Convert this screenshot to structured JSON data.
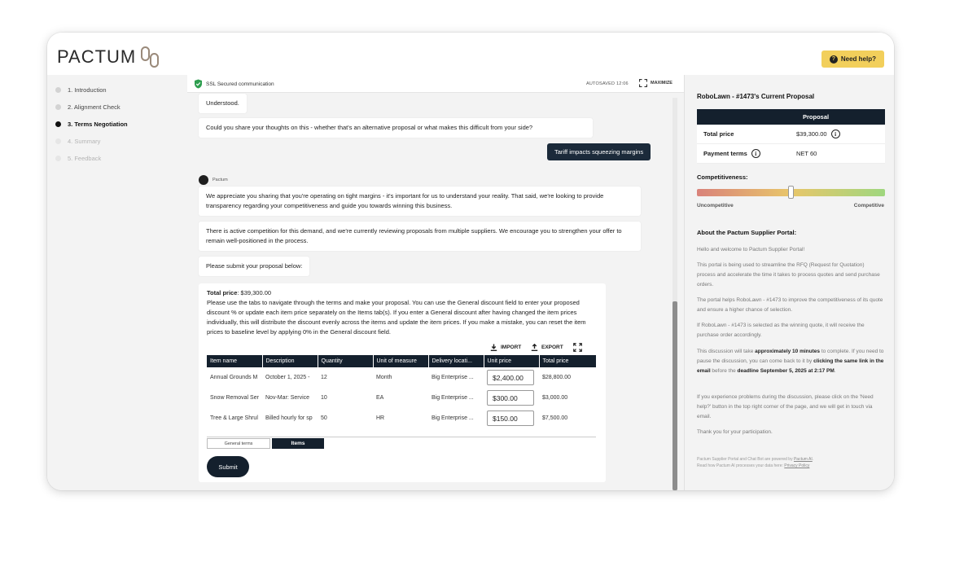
{
  "header": {
    "logo_text": "PACTUM",
    "help_label": "Need help?"
  },
  "sidebar": {
    "steps": [
      {
        "label": "1. Introduction",
        "state": "done"
      },
      {
        "label": "2. Alignment Check",
        "state": "done"
      },
      {
        "label": "3. Terms Negotiation",
        "state": "active"
      },
      {
        "label": "4. Summary",
        "state": "future"
      },
      {
        "label": "5. Feedback",
        "state": "future"
      }
    ]
  },
  "chat_header": {
    "ssl_text": "SSL Secured communication",
    "autosave": "AUTOSAVED 12:06",
    "maximize": "MAXIMIZE"
  },
  "chat": {
    "m1": "Understood.",
    "m2": "Could you share your thoughts on this - whether that's an alternative proposal or what makes this difficult from your side?",
    "user_reply": "Tariff impacts squeezing margins",
    "sender": "Pactum",
    "m3": "We appreciate you sharing that you're operating on tight margins - it's important for us to understand your reality. That said, we're looking to provide transparency regarding your competitiveness and guide you towards winning this business.",
    "m4": "There is active competition for this demand, and we're currently reviewing proposals from multiple suppliers. We encourage you to strengthen your offer to remain well-positioned in the process.",
    "m5": "Please submit your proposal below:"
  },
  "proposal_form": {
    "total_label": "Total price",
    "total_value": ": $39,300.00",
    "instructions": "Please use the tabs to navigate through the terms and make your proposal. You can use the General discount field to enter your proposed discount % or update each item price separately on the Items tab(s). If you enter a General discount after having changed the item prices individually, this will distribute the discount evenly across the items and update the item prices. If you make a mistake, you can reset the item prices to baseline level by applying 0% in the General discount field.",
    "import_label": "IMPORT",
    "export_label": "EXPORT",
    "columns": [
      "Item name",
      "Description",
      "Quantity",
      "Unit of measure",
      "Delivery locati...",
      "Unit price",
      "Total price"
    ],
    "rows": [
      {
        "name": "Annual Grounds M",
        "description": "October 1, 2025 -",
        "quantity": "12",
        "unit": "Month",
        "delivery": "Big Enterprise ...",
        "unit_price": "$2,400.00",
        "total": "$28,800.00"
      },
      {
        "name": "Snow Removal Ser",
        "description": "Nov-Mar: Service",
        "quantity": "10",
        "unit": "EA",
        "delivery": "Big Enterprise ...",
        "unit_price": "$300.00",
        "total": "$3,000.00"
      },
      {
        "name": "Tree & Large Shrul",
        "description": "Billed hourly for sp",
        "quantity": "50",
        "unit": "HR",
        "delivery": "Big Enterprise ...",
        "unit_price": "$150.00",
        "total": "$7,500.00"
      }
    ],
    "tab_general": "General terms",
    "tab_items": "Items",
    "submit_label": "Submit"
  },
  "right_panel": {
    "title": "RoboLawn - #1473's Current Proposal",
    "proposal_header": "Proposal",
    "total_label": "Total price",
    "total_value": "$39,300.00",
    "payment_label": "Payment terms",
    "payment_value": "NET 60",
    "competitiveness_label": "Competitiveness:",
    "competitiveness_level": 0.5,
    "uncompetitive": "Uncompetitive",
    "competitive": "Competitive",
    "about_title": "About the Pactum Supplier Portal:",
    "p1": "Hello and welcome to Pactum Supplier Portal!",
    "p2": "This portal is being used to streamline the RFQ (Request for Quotation) process and accelerate the time it takes to process quotes and send purchase orders.",
    "p3": "The portal helps RoboLawn - #1473 to improve the competitiveness of its quote and ensure a higher chance of selection.",
    "p4": "If RoboLawn - #1473 is selected as the winning quote, it will receive the purchase order accordingly.",
    "p5_a": "This discussion will take ",
    "p5_b": "approximately 10 minutes",
    "p5_c": " to complete. If you need to pause the discussion, you can come back to it by ",
    "p5_d": "clicking the same link in the email",
    "p5_e": " before the ",
    "p5_f": "deadline September 5, 2025 at 2:17 PM",
    "p5_g": ".",
    "p6": "If you experience problems during the discussion, please click on the 'Need help?' button in the top right corner of the page, and we will get in touch via email.",
    "p7": "Thank you for your participation.",
    "footer_a": "Pactum Supplier Portal and Chat Bot are powered by ",
    "footer_link1": "Pactum AI",
    "footer_b": ".",
    "footer_c": "Read how Pactum AI processes your data here: ",
    "footer_link2": "Privacy Policy"
  }
}
